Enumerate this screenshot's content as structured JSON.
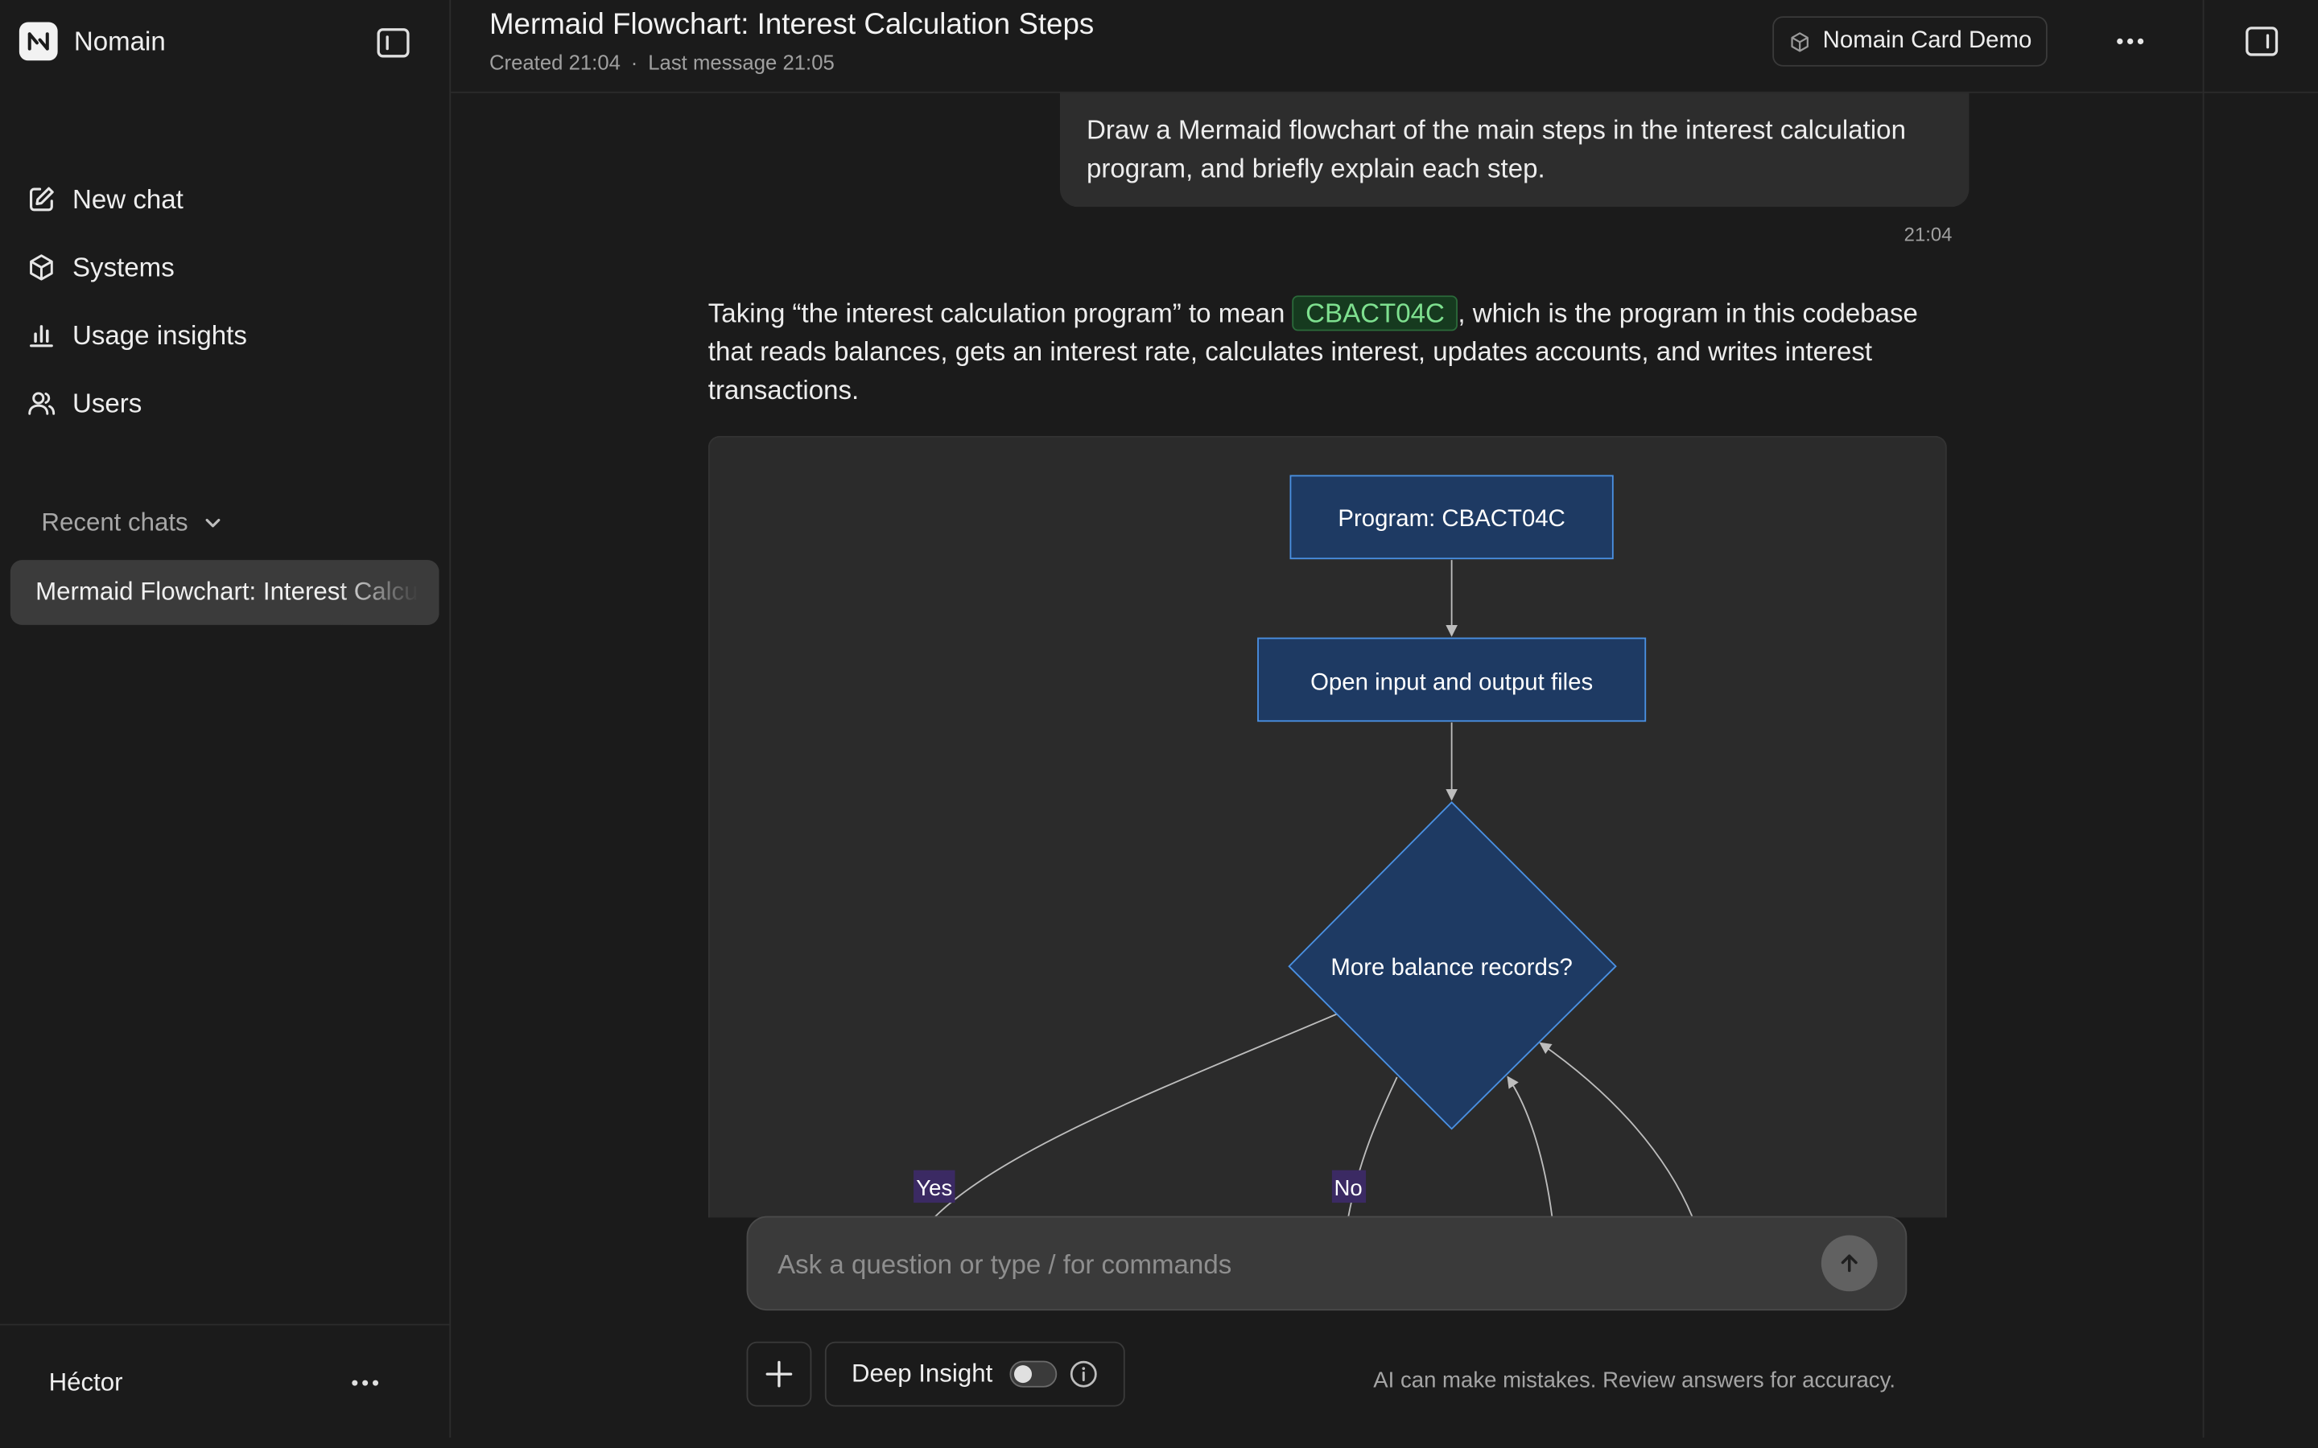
{
  "app": {
    "name": "Nomain",
    "logo_glyph": "N"
  },
  "sidebar": {
    "nav": [
      {
        "label": "New chat",
        "icon": "edit-icon"
      },
      {
        "label": "Systems",
        "icon": "cube-icon"
      },
      {
        "label": "Usage insights",
        "icon": "bar-chart-icon"
      },
      {
        "label": "Users",
        "icon": "users-icon"
      }
    ],
    "recent_header": "Recent chats",
    "recent_chats": [
      {
        "label": "Mermaid Flowchart: Interest Calculation Steps",
        "active": true
      }
    ],
    "user_name": "Héctor"
  },
  "header": {
    "title": "Mermaid Flowchart: Interest Calculation Steps",
    "created": "Created 21:04",
    "separator": "·",
    "last_message": "Last message 21:05",
    "system_chip": "Nomain Card Demo"
  },
  "conversation": {
    "user_message": "Draw a Mermaid flowchart of the main steps in the interest calculation program, and briefly explain each step.",
    "user_time": "21:04",
    "assistant_pre": "Taking “the interest calculation program” to mean ",
    "assistant_code": "CBACT04C",
    "assistant_post": ", which is the program in this codebase that reads balances, gets an interest rate, calculates interest, updates accounts, and writes interest transactions."
  },
  "flowchart": {
    "nodes": {
      "program": "Program: CBACT04C",
      "open_files": "Open input and output files",
      "decision": "More balance records?"
    },
    "edge_labels": {
      "yes": "Yes",
      "no": "No"
    },
    "colors": {
      "node_fill": "#1e3a63",
      "node_stroke": "#4a90e2",
      "edge": "#bdbdbd",
      "edge_label_bg": "#3b2a63"
    }
  },
  "composer": {
    "placeholder": "Ask a question or type / for commands",
    "deep_insight_label": "Deep Insight",
    "deep_insight_enabled": false,
    "disclaimer": "AI can make mistakes. Review answers for accuracy."
  }
}
